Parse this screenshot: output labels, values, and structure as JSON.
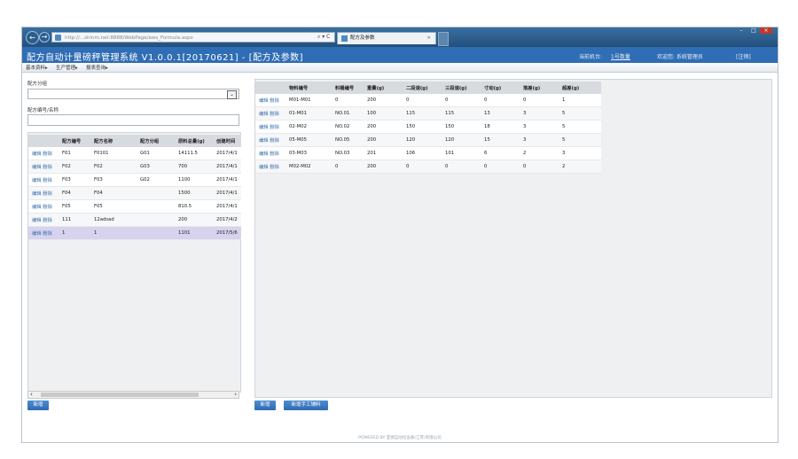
{
  "browser": {
    "url": "http://...shinm.net:8888/WebPage/aws_Formula.aspx",
    "tools": "⌕ ▾ C",
    "tab_title": "配方及参数",
    "tab_close": "×"
  },
  "header": {
    "title": "配方自动计量磅秤管理系统 V1.0.0.1[20170621] - [配方及参数]",
    "machine_label": "当前机台:",
    "machine_value": "1号数量",
    "welcome": "欢迎您: 系统管理员",
    "logout": "[注销]"
  },
  "menu": [
    "基本资料▸",
    "生产管理▸",
    "报表查询▸"
  ],
  "left": {
    "group_label": "配方分组",
    "search_label": "配方编号/名称",
    "columns": [
      "",
      "配方编号",
      "配方名称",
      "配方分组",
      "原料总量(g)",
      "创建时间"
    ],
    "rows": [
      [
        "编辑 删除",
        "F01",
        "F0101",
        "G01",
        "14111.5",
        "2017/4/1"
      ],
      [
        "编辑 删除",
        "F02",
        "F02",
        "G03",
        "700",
        "2017/4/1"
      ],
      [
        "编辑 删除",
        "F03",
        "F03",
        "G02",
        "1100",
        "2017/4/1"
      ],
      [
        "编辑 删除",
        "F04",
        "F04",
        "",
        "1500",
        "2017/4/1"
      ],
      [
        "编辑 删除",
        "F05",
        "F05",
        "",
        "810.5",
        "2017/4/1"
      ],
      [
        "编辑 删除",
        "111",
        "12adsad",
        "",
        "200",
        "2017/4/2"
      ],
      [
        "编辑 删除",
        "1",
        "1",
        "",
        "1101",
        "2017/5/6"
      ]
    ],
    "add_label": "新增"
  },
  "right": {
    "columns": [
      "",
      "物料编号",
      "料桶编号",
      "重量(g)",
      "二段速(g)",
      "三段速(g)",
      "寸动(g)",
      "落差(g)",
      "超差(g)"
    ],
    "rows": [
      [
        "编辑 删除",
        "M01-M01",
        "0",
        "200",
        "0",
        "0",
        "0",
        "0",
        "1"
      ],
      [
        "编辑 删除",
        "01-M01",
        "NO.01",
        "100",
        "115",
        "115",
        "13",
        "3",
        "5"
      ],
      [
        "编辑 删除",
        "02-M02",
        "NO.02",
        "200",
        "150",
        "150",
        "18",
        "3",
        "5"
      ],
      [
        "编辑 删除",
        "05-M05",
        "NO.05",
        "200",
        "120",
        "120",
        "15",
        "3",
        "5"
      ],
      [
        "编辑 删除",
        "03-M03",
        "NO.03",
        "201",
        "106",
        "101",
        "6",
        "2",
        "3"
      ],
      [
        "编辑 删除",
        "M02-M02",
        "0",
        "200",
        "0",
        "0",
        "0",
        "0",
        "2"
      ]
    ],
    "add_label": "新增",
    "add_manual_label": "新增手工辅料"
  },
  "footer": "POWERED BY 亚德自动化设备(江苏)有限公司",
  "colors": {
    "header": "#2f6db4",
    "button": "#2e6ab3",
    "link": "#3a6fb0",
    "selected_row": "#d7d3ee"
  }
}
